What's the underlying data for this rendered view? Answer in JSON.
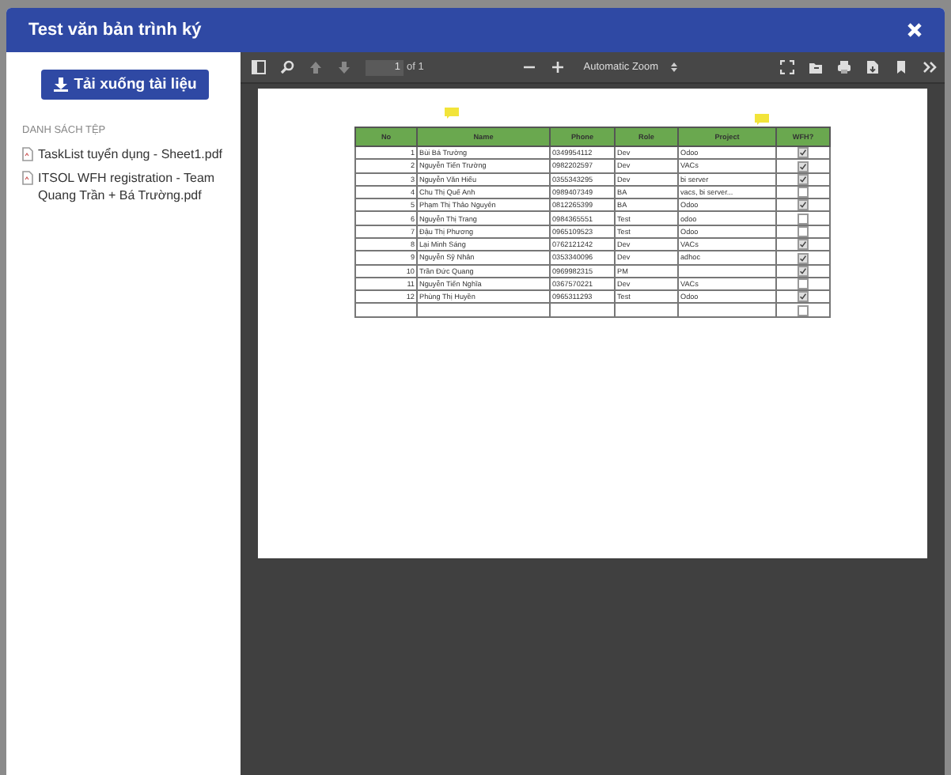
{
  "dialog": {
    "title": "Test văn bản trình ký"
  },
  "sidebar": {
    "download_button": "Tải xuống tài liệu",
    "section_heading": "DANH SÁCH TỆP",
    "files": [
      {
        "name": "TaskList tuyển dụng - Sheet1.pdf"
      },
      {
        "name": "ITSOL WFH registration - Team Quang Trần + Bá Trường.pdf"
      }
    ]
  },
  "viewer": {
    "toolbar": {
      "page_number": "1",
      "page_count": "of 1",
      "zoom": "Automatic Zoom"
    },
    "table": {
      "columns": [
        "No",
        "Name",
        "Phone",
        "Role",
        "Project",
        "WFH?"
      ],
      "rows": [
        {
          "no": "1",
          "name": "Bùi Bá Trường",
          "phone": "0349954112",
          "role": "Dev",
          "project": "Odoo",
          "wfh": true
        },
        {
          "no": "2",
          "name": "Nguyễn Tiến Trường",
          "phone": "0982202597",
          "role": "Dev",
          "project": "VACs",
          "wfh": true
        },
        {
          "no": "3",
          "name": "Nguyễn Văn Hiếu",
          "phone": "0355343295",
          "role": "Dev",
          "project": "bi server",
          "wfh": true
        },
        {
          "no": "4",
          "name": "Chu Thị Quế Anh",
          "phone": "0989407349",
          "role": "BA",
          "project": "vacs, bi server...",
          "wfh": false
        },
        {
          "no": "5",
          "name": "Phạm Thị Thảo Nguyên",
          "phone": "0812265399",
          "role": "BA",
          "project": "Odoo",
          "wfh": true
        },
        {
          "no": "6",
          "name": "Nguyễn Thị Trang",
          "phone": "0984365551",
          "role": "Test",
          "project": "odoo",
          "wfh": false
        },
        {
          "no": "7",
          "name": "Đậu Thị Phương",
          "phone": "0965109523",
          "role": "Test",
          "project": "Odoo",
          "wfh": false
        },
        {
          "no": "8",
          "name": "Lại Minh Sáng",
          "phone": "0762121242",
          "role": "Dev",
          "project": "VACs",
          "wfh": true
        },
        {
          "no": "9",
          "name": "Nguyễn Sỹ Nhân",
          "phone": "0353340096",
          "role": "Dev",
          "project": "adhoc",
          "wfh": true
        },
        {
          "no": "10",
          "name": "Trần Đức Quang",
          "phone": "0969982315",
          "role": "PM",
          "wfh": true
        },
        {
          "no": "11",
          "name": "Nguyễn Tiến Nghĩa",
          "phone": "0367570221",
          "role": "Dev",
          "project": "VACs",
          "wfh": false
        },
        {
          "no": "12",
          "name": "Phùng Thị Huyền",
          "phone": "0965311293",
          "role": "Test",
          "project": "Odoo",
          "wfh": true
        },
        {
          "wfh": false
        }
      ]
    }
  }
}
